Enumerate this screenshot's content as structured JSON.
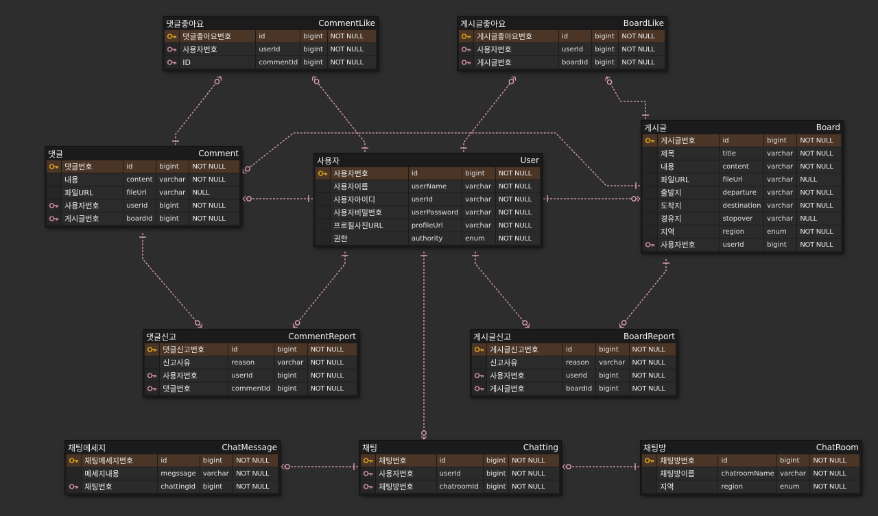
{
  "colors": {
    "background": "#2d2d2d",
    "table_bg": "#1b1b1b",
    "row_bg": "#2b2b2b",
    "pk_row_bg": "#4a3526",
    "pk_key": "#d9a21c",
    "fk_key": "#c98aa6",
    "relation_line": "#e0a3b8"
  },
  "entities": [
    {
      "id": "CommentLike",
      "name_ko": "댓글좋아요",
      "name_en": "CommentLike",
      "columns": [
        {
          "key": "pk",
          "name": "댓글좋아요번호",
          "field": "id",
          "type": "bigint",
          "null": "NOT NULL"
        },
        {
          "key": "fk",
          "name": "사용자번호",
          "field": "userId",
          "type": "bigint",
          "null": "NOT NULL"
        },
        {
          "key": "fk",
          "name": "ID",
          "field": "commentId",
          "type": "bigint",
          "null": "NOT NULL"
        }
      ]
    },
    {
      "id": "BoardLike",
      "name_ko": "게시글좋아요",
      "name_en": "BoardLike",
      "columns": [
        {
          "key": "pk",
          "name": "게시글좋아요번호",
          "field": "id",
          "type": "bigint",
          "null": "NOT NULL"
        },
        {
          "key": "fk",
          "name": "사용자번호",
          "field": "userId",
          "type": "bigint",
          "null": "NOT NULL"
        },
        {
          "key": "fk",
          "name": "게시글번호",
          "field": "boardId",
          "type": "bigint",
          "null": "NOT NULL"
        }
      ]
    },
    {
      "id": "Comment",
      "name_ko": "댓글",
      "name_en": "Comment",
      "columns": [
        {
          "key": "pk",
          "name": "댓글번호",
          "field": "id",
          "type": "bigint",
          "null": "NOT NULL"
        },
        {
          "key": "",
          "name": "내용",
          "field": "content",
          "type": "varchar",
          "null": "NOT NULL"
        },
        {
          "key": "",
          "name": "파일URL",
          "field": "fileUrl",
          "type": "varchar",
          "null": "NULL"
        },
        {
          "key": "fk",
          "name": "사용자번호",
          "field": "userId",
          "type": "bigint",
          "null": "NOT NULL"
        },
        {
          "key": "fk",
          "name": "게시글번호",
          "field": "boardId",
          "type": "bigint",
          "null": "NOT NULL"
        }
      ]
    },
    {
      "id": "User",
      "name_ko": "사용자",
      "name_en": "User",
      "columns": [
        {
          "key": "pk",
          "name": "사용자번호",
          "field": "id",
          "type": "bigint",
          "null": "NOT NULL"
        },
        {
          "key": "",
          "name": "사용자이름",
          "field": "userName",
          "type": "varchar",
          "null": "NOT NULL"
        },
        {
          "key": "",
          "name": "사용자아이디",
          "field": "userId",
          "type": "varchar",
          "null": "NOT NULL"
        },
        {
          "key": "",
          "name": "사용자비밀번호",
          "field": "userPassword",
          "type": "varchar",
          "null": "NOT NULL"
        },
        {
          "key": "",
          "name": "프로필사진URL",
          "field": "profileUrl",
          "type": "varchar",
          "null": "NOT NULL"
        },
        {
          "key": "",
          "name": "권한",
          "field": "authority",
          "type": "enum",
          "null": "NOT NULL"
        }
      ]
    },
    {
      "id": "Board",
      "name_ko": "게시글",
      "name_en": "Board",
      "columns": [
        {
          "key": "pk",
          "name": "게시글번호",
          "field": "id",
          "type": "bigint",
          "null": "NOT NULL"
        },
        {
          "key": "",
          "name": "제목",
          "field": "title",
          "type": "varchar",
          "null": "NOT NULL"
        },
        {
          "key": "",
          "name": "내용",
          "field": "content",
          "type": "varchar",
          "null": "NOT NULL"
        },
        {
          "key": "",
          "name": "파일URL",
          "field": "fileUrl",
          "type": "varchar",
          "null": "NULL"
        },
        {
          "key": "",
          "name": "출발지",
          "field": "departure",
          "type": "varchar",
          "null": "NOT NULL"
        },
        {
          "key": "",
          "name": "도착지",
          "field": "destination",
          "type": "varchar",
          "null": "NOT NULL"
        },
        {
          "key": "",
          "name": "경유지",
          "field": "stopover",
          "type": "varchar",
          "null": "NULL"
        },
        {
          "key": "",
          "name": "지역",
          "field": "region",
          "type": "enum",
          "null": "NOT NULL"
        },
        {
          "key": "fk",
          "name": "사용자번호",
          "field": "userId",
          "type": "bigint",
          "null": "NOT NULL"
        }
      ]
    },
    {
      "id": "CommentReport",
      "name_ko": "댓글신고",
      "name_en": "CommentReport",
      "columns": [
        {
          "key": "pk",
          "name": "댓글신고번호",
          "field": "id",
          "type": "bigint",
          "null": "NOT NULL"
        },
        {
          "key": "",
          "name": "신고사유",
          "field": "reason",
          "type": "varchar",
          "null": "NOT NULL"
        },
        {
          "key": "fk",
          "name": "사용자번호",
          "field": "userId",
          "type": "bigint",
          "null": "NOT NULL"
        },
        {
          "key": "fk",
          "name": "댓글번호",
          "field": "commentId",
          "type": "bigint",
          "null": "NOT NULL"
        }
      ]
    },
    {
      "id": "BoardReport",
      "name_ko": "게시글신고",
      "name_en": "BoardReport",
      "columns": [
        {
          "key": "pk",
          "name": "게시글신고번호",
          "field": "id",
          "type": "bigint",
          "null": "NOT NULL"
        },
        {
          "key": "",
          "name": "신고사유",
          "field": "reason",
          "type": "varchar",
          "null": "NOT NULL"
        },
        {
          "key": "fk",
          "name": "사용자번호",
          "field": "userId",
          "type": "bigint",
          "null": "NOT NULL"
        },
        {
          "key": "fk",
          "name": "게시글번호",
          "field": "boardId",
          "type": "bigint",
          "null": "NOT NULL"
        }
      ]
    },
    {
      "id": "ChatMessage",
      "name_ko": "채팅메세지",
      "name_en": "ChatMessage",
      "columns": [
        {
          "key": "pk",
          "name": "채팅메세지번호",
          "field": "id",
          "type": "bigint",
          "null": "NOT NULL"
        },
        {
          "key": "",
          "name": "메세지내용",
          "field": "megssage",
          "type": "varchar",
          "null": "NOT NULL"
        },
        {
          "key": "fk",
          "name": "채팅번호",
          "field": "chattingId",
          "type": "bigint",
          "null": "NOT NULL"
        }
      ]
    },
    {
      "id": "Chatting",
      "name_ko": "채팅",
      "name_en": "Chatting",
      "columns": [
        {
          "key": "pk",
          "name": "채팅번호",
          "field": "id",
          "type": "bigint",
          "null": "NOT NULL"
        },
        {
          "key": "fk",
          "name": "사용자번호",
          "field": "userId",
          "type": "bigint",
          "null": "NOT NULL"
        },
        {
          "key": "fk",
          "name": "채팅방번호",
          "field": "chatroomId",
          "type": "bigint",
          "null": "NOT NULL"
        }
      ]
    },
    {
      "id": "ChatRoom",
      "name_ko": "채팅방",
      "name_en": "ChatRoom",
      "columns": [
        {
          "key": "pk",
          "name": "채팅방번호",
          "field": "id",
          "type": "bigint",
          "null": "NOT NULL"
        },
        {
          "key": "",
          "name": "채팅방이름",
          "field": "chatroomName",
          "type": "varchar",
          "null": "NOT NULL"
        },
        {
          "key": "",
          "name": "지역",
          "field": "region",
          "type": "enum",
          "null": "NOT NULL"
        }
      ]
    }
  ],
  "relations": [
    {
      "from": "User",
      "to": "CommentLike"
    },
    {
      "from": "Comment",
      "to": "CommentLike"
    },
    {
      "from": "User",
      "to": "BoardLike"
    },
    {
      "from": "Board",
      "to": "BoardLike"
    },
    {
      "from": "User",
      "to": "Comment"
    },
    {
      "from": "Board",
      "to": "Comment"
    },
    {
      "from": "User",
      "to": "Board"
    },
    {
      "from": "Comment",
      "to": "CommentReport"
    },
    {
      "from": "User",
      "to": "CommentReport"
    },
    {
      "from": "User",
      "to": "BoardReport"
    },
    {
      "from": "Board",
      "to": "BoardReport"
    },
    {
      "from": "User",
      "to": "Chatting"
    },
    {
      "from": "Chatting",
      "to": "ChatMessage"
    },
    {
      "from": "ChatRoom",
      "to": "Chatting"
    }
  ]
}
